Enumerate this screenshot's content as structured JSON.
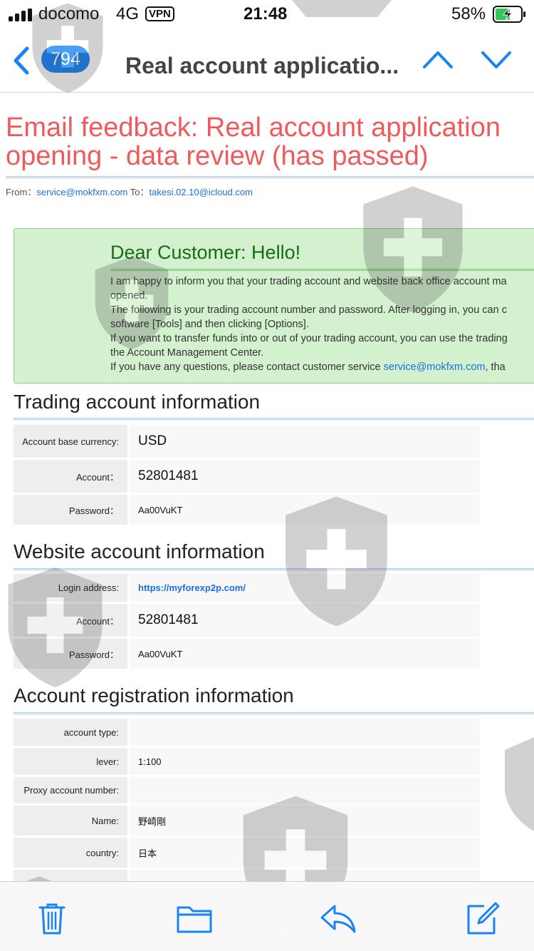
{
  "status_bar": {
    "carrier": "docomo",
    "network": "4G",
    "vpn": "VPN",
    "time": "21:48",
    "battery": "58%"
  },
  "nav": {
    "count": "794",
    "title": "Real account applicatio..."
  },
  "email": {
    "heading": "Email feedback: Real account application opening - data review (has passed)",
    "from_label": "From：",
    "from": "service@mokfxm.com",
    "to_label": " To：",
    "to": "takesi.02.10@icloud.com"
  },
  "notice": {
    "title": "Dear Customer: Hello!",
    "line1": "I am happy to inform you that your trading account and website back office account ma",
    "line2": "opened.",
    "line3": "The following is your trading account number and password. After logging in, you can c",
    "line4": "software [Tools] and then clicking [Options].",
    "line5": "If you want to transfer funds into or out of your trading account, you can use the trading",
    "line6": "the Account Management Center.",
    "line7_prefix": "If you have any questions, please contact customer service ",
    "line7_link": "service@mokfxm.com",
    "line7_suffix": ", tha"
  },
  "trading": {
    "title": "Trading account information",
    "currency_label": "Account base currency:",
    "currency_value": "USD",
    "account_label": "Account：",
    "account_value": "52801481",
    "password_label": "Password：",
    "password_value": "Aa00VuKT"
  },
  "website": {
    "title": "Website account information",
    "login_label": "Login address:",
    "login_value": "https://myforexp2p.com/",
    "account_label": "Account：",
    "account_value": "52801481",
    "password_label": "Password：",
    "password_value": "Aa00VuKT"
  },
  "registration": {
    "title": "Account registration information",
    "type_label": "account type:",
    "type_value": "",
    "lever_label": "lever:",
    "lever_value": "1:100",
    "proxy_label": "Proxy account number:",
    "proxy_value": "",
    "name_label": "Name:",
    "name_value": "野崎剛",
    "country_label": "country:",
    "country_value": "日本"
  },
  "colors": {
    "accent": "#1a84f5",
    "heading_red": "#f15a5a",
    "notice_bg": "#d4f1cf",
    "notice_title": "#166b14"
  },
  "icons": {
    "back": "chevron-left-icon",
    "prev": "chevron-up-icon",
    "next": "chevron-down-icon",
    "trash": "trash-icon",
    "folder": "folder-icon",
    "reply": "reply-icon",
    "compose": "compose-icon",
    "watermark": "shield-watermark-icon"
  }
}
